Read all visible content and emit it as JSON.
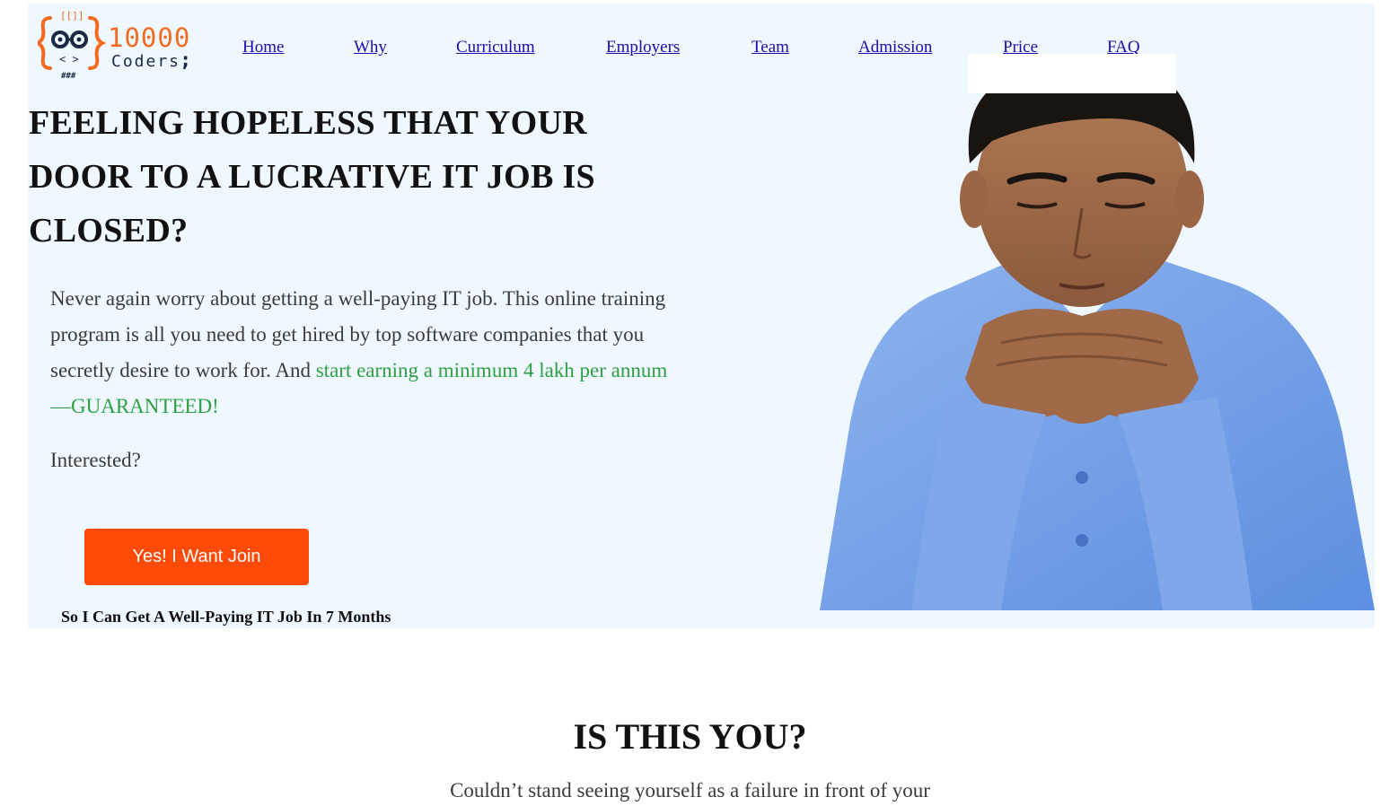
{
  "brand": {
    "logo_number": "10000",
    "logo_text": "Coders",
    "logo_semicolon": ";",
    "logo_brackets_top": "[[]]",
    "logo_brackets_bottom": "< >",
    "logo_hash": "###",
    "colors": {
      "orange": "#f26b21",
      "navy": "#1c2942",
      "cta": "#ff4a08",
      "link": "#1a0dab",
      "highlight": "#2ea043",
      "hero_bg": "#eff7ff"
    }
  },
  "nav": {
    "items": [
      "Home",
      "Why",
      "Curriculum",
      "Employers",
      "Team",
      "Admission",
      "Price",
      "FAQ"
    ]
  },
  "hero": {
    "headline": "FEELING HOPELESS THAT YOUR DOOR TO A LUCRATIVE IT JOB IS CLOSED?",
    "intro_text": "Never again worry about getting a well-paying IT job. This online training program is all you need to get hired by top software companies that you secretly desire to work for. And ",
    "intro_highlight": "start earning a minimum 4 lakh per annum—GUARANTEED!",
    "question": "Interested?",
    "cta_label": "Yes! I Want Join",
    "cta_subtext": "So I Can Get A Well-Paying IT Job In 7 Months",
    "image": "thoughtful-young-man-in-blue-shirt"
  },
  "section": {
    "title": "IS THIS YOU?",
    "text": "Couldn’t stand seeing yourself as a failure in front of your"
  }
}
